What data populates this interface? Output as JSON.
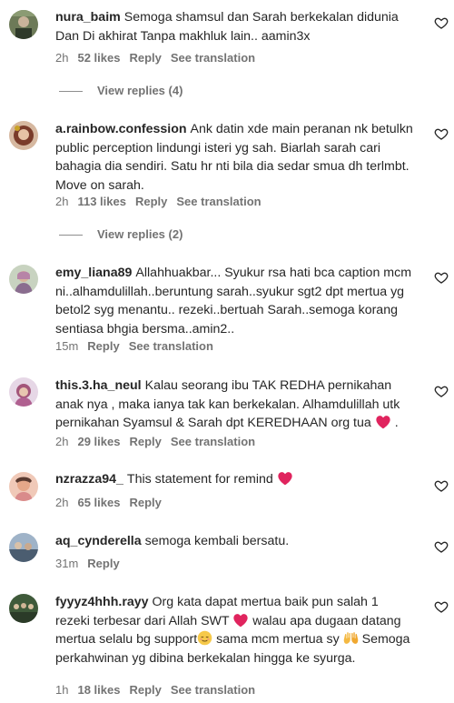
{
  "comments": [
    {
      "user": "nura_baim",
      "text": "Semoga shamsul dan Sarah berkekalan didunia Dan Di akhirat Tanpa makhluk lain.. aamin3x",
      "time": "2h",
      "likes": "52 likes",
      "reply": "Reply",
      "translate": "See translation",
      "view_replies": "View replies (4)"
    },
    {
      "user": "a.rainbow.confession",
      "text": "Ank datin xde main peranan nk betulkn public perception lindungi isteri yg sah. Biarlah sarah cari bahagia dia sendiri. Satu hr nti bila dia sedar smua dh terlmbt. Move on sarah.",
      "time": "2h",
      "likes": "113 likes",
      "reply": "Reply",
      "translate": "See translation",
      "view_replies": "View replies (2)"
    },
    {
      "user": "emy_liana89",
      "text": "Allahhuakbar... Syukur rsa hati bca caption mcm ni..alhamdulillah..beruntung sarah..syukur sgt2 dpt mertua yg betol2 syg menantu.. rezeki..bertuah Sarah..semoga korang sentiasa bhgia bersma..amin2..",
      "time": "15m",
      "reply": "Reply",
      "translate": "See translation"
    },
    {
      "user": "this.3.ha_neul",
      "text": "Kalau seorang ibu TAK REDHA pernikahan anak nya , maka ianya tak kan berkekalan. Alhamdulillah utk pernikahan Syamsul & Sarah dpt KEREDHAAN org tua",
      "text_end": ".",
      "time": "2h",
      "likes": "29 likes",
      "reply": "Reply",
      "translate": "See translation"
    },
    {
      "user": "nzrazza94_",
      "text": "This statement for remind",
      "time": "2h",
      "likes": "65 likes",
      "reply": "Reply"
    },
    {
      "user": "aq_cynderella",
      "text": "semoga kembali bersatu.",
      "time": "31m",
      "reply": "Reply"
    },
    {
      "user": "fyyyz4hhh.rayy",
      "text_a": "Org kata dapat mertua baik pun salah 1 rezeki terbesar dari Allah SWT",
      "text_b": "walau apa dugaan datang mertua selalu bg support",
      "text_c": "sama mcm mertua sy",
      "text_d": "Semoga perkahwinan yg dibina berkekalan hingga ke syurga.",
      "time": "1h",
      "likes": "18 likes",
      "reply": "Reply",
      "translate": "See translation"
    }
  ],
  "colors": {
    "text": "#262626",
    "meta": "#737373",
    "emoji_heart": "#e0245e"
  }
}
